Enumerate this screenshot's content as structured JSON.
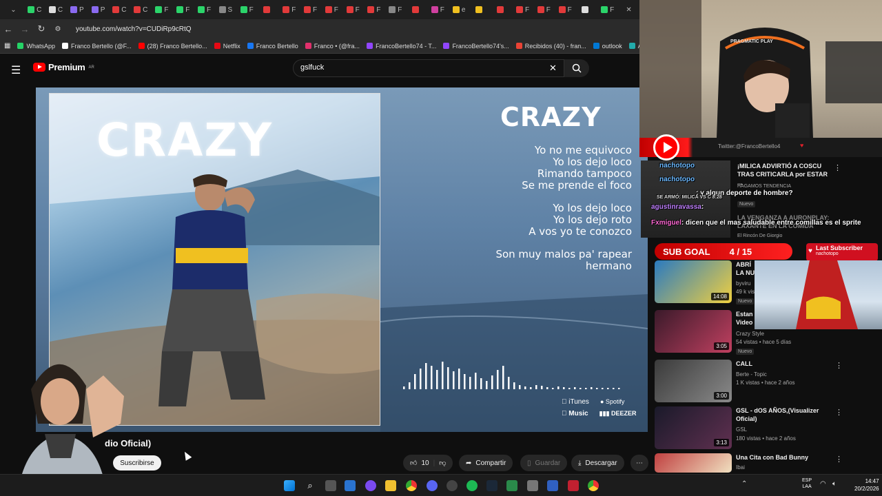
{
  "browser": {
    "url": "youtube.com/watch?v=CUDiRp9cRtQ",
    "tabs": [
      "C",
      "C",
      "P",
      "P",
      "C",
      "C",
      "F",
      "F",
      "F",
      "S",
      "F",
      "",
      "F",
      "F",
      "F",
      "F",
      "F",
      "F",
      "",
      "F",
      "e",
      "",
      "",
      "F",
      "F",
      "F",
      "",
      "F"
    ],
    "bookmarks": [
      "WhatsApp",
      "Franco Bertello (@F...",
      "(28) Franco Bertello...",
      "Netflix",
      "Franco Bertello",
      "Franco • (@fra...",
      "FrancoBertello74 - T...",
      "FrancoBertello74's...",
      "Recibidos (40) - fran...",
      "outlook",
      "Aler"
    ]
  },
  "youtube": {
    "logo_text": "Premium",
    "logo_region": "AR",
    "search_value": "gslfuck",
    "video": {
      "cover_title": "CRAZY",
      "lyric_title": "CRAZY",
      "lyrics": [
        "Yo no me equivoco",
        "Yo los dejo loco",
        "Rimando tampoco",
        "Se me prende el foco",
        "",
        "Yo los dejo loco",
        "Yo los dejo roto",
        "A vos yo te conozco",
        "",
        "Son muy malos pa' rapear",
        "hermano"
      ],
      "stores": {
        "itunes": "iTunes",
        "spotify": "Spotify",
        "music": "Music",
        "deezer": "DEEZER"
      }
    },
    "title_fragment": "dio Oficial)",
    "subs_fragment": "res",
    "subscribe_label": "Suscribirse",
    "like_count": "10",
    "share_label": "Compartir",
    "save_label": "Guardar",
    "download_label": "Descargar",
    "recommendations": [
      {
        "title": "¡MILICA ADVIRTIÓ A COSCU TRAS CRITICARLA por ESTAR ...",
        "channel": "HAGAMOS TENDENCIA",
        "meta": "",
        "badge": "Nuevo",
        "duration": ""
      },
      {
        "title": "LA VENGANZA A AURONPLAY: LAXANTE EN LA COMIDA",
        "channel": "El Rincón De Giorgio",
        "meta": "",
        "badge": "",
        "duration": ""
      },
      {
        "title": "ABRÍ LA NU",
        "channel": "byviru",
        "meta": "49 k vis",
        "badge": "Nuevo",
        "duration": "14:08"
      },
      {
        "title": "Estan Video",
        "channel": "Crazy Style",
        "meta": "54 vistas • hace 5 días",
        "badge": "Nuevo",
        "duration": "3:05"
      },
      {
        "title": "CALL",
        "channel": "Berte - Topic",
        "meta": "1 K vistas • hace 2 años",
        "badge": "",
        "duration": "3:00"
      },
      {
        "title": "GSL - dOS AÑOS,(Visualizer Oficial)",
        "channel": "GSL",
        "meta": "180 vistas • hace 2 años",
        "badge": "",
        "duration": "3:13"
      },
      {
        "title": "Una Cita con Bad Bunny",
        "channel": "Ibai",
        "meta": "",
        "badge": "",
        "duration": ""
      }
    ]
  },
  "stream": {
    "twitter_handle": "Twitter:@FrancoBertello4",
    "chat": [
      {
        "user": "nachotopo",
        "msg": ""
      },
      {
        "user": "nachotopo",
        "msg": ": y algun deporte de hombre?"
      },
      {
        "user": "SE ARMÓ: MILICA VS C",
        "msg": "8:28"
      },
      {
        "user": "agustinravassa",
        "msg": ":"
      },
      {
        "user": "Fxmiguel",
        "msg": ": dicen que el mas saludable entre comillas es el sprite"
      }
    ],
    "sub_goal_label": "SUB GOAL",
    "sub_goal_value": "4 / 15",
    "last_subscriber_label": "Last Subscriber",
    "last_subscriber_name": "nachotopo",
    "chair_brand": "PRAGMATIC PLAY"
  },
  "taskbar": {
    "lang_top": "ESP",
    "lang_bottom": "LAA",
    "time": "14:47",
    "date": "20/2/2026"
  }
}
